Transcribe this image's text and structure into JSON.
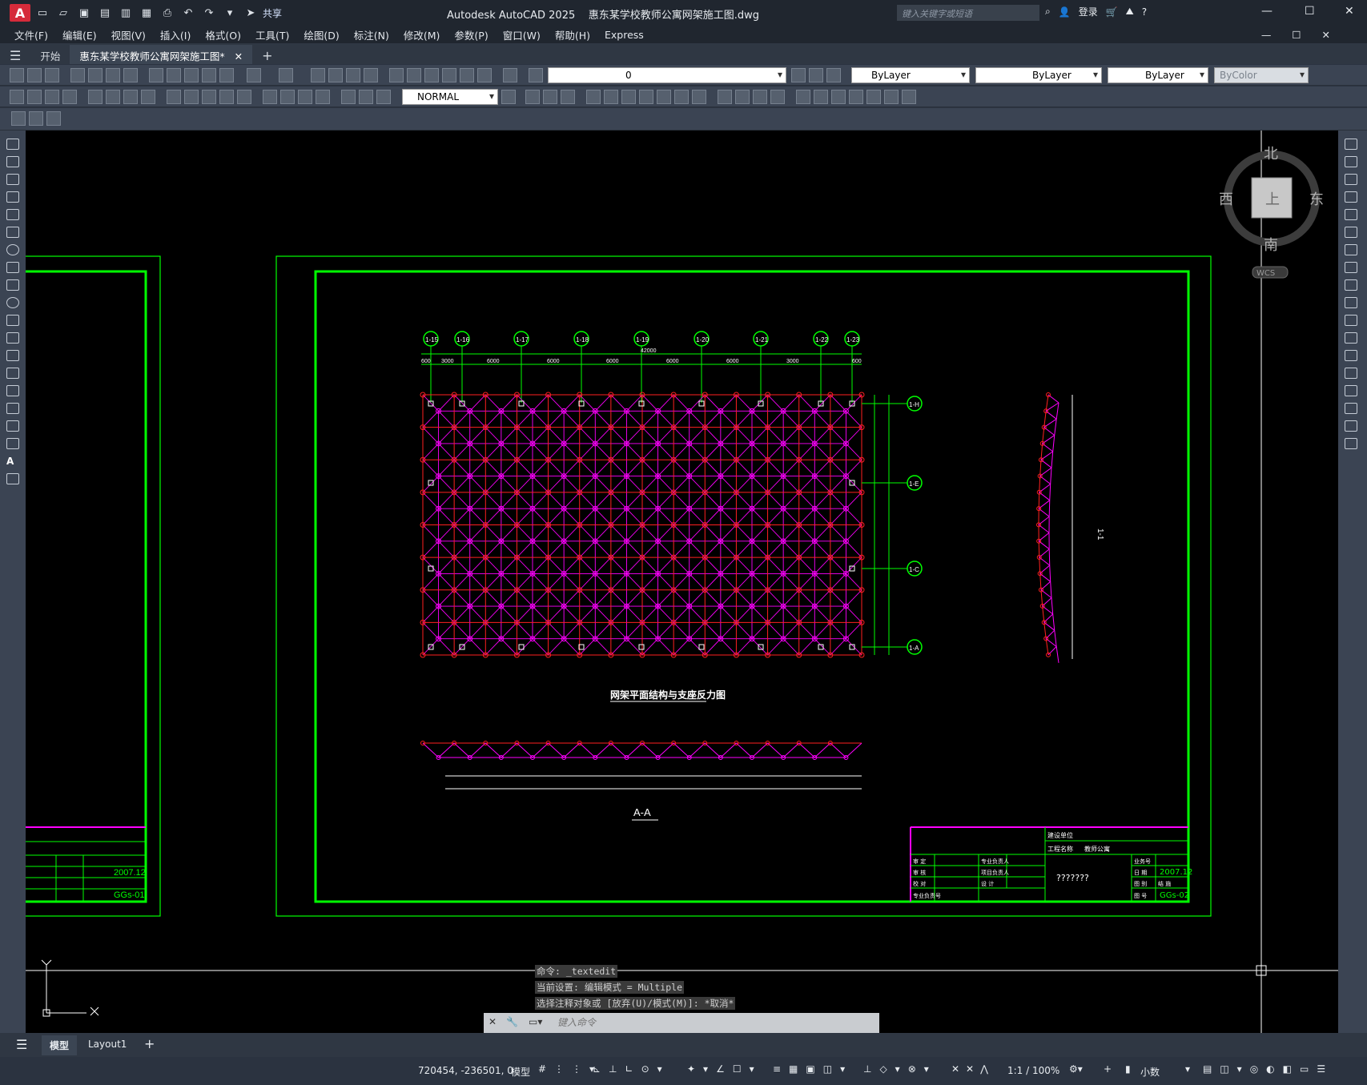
{
  "app": {
    "title": "Autodesk AutoCAD 2025",
    "file": "惠东某学校教师公寓网架施工图.dwg",
    "logo": "A",
    "share": "共享",
    "search_placeholder": "键入关键字或短语",
    "login": "登录"
  },
  "menu": [
    "文件(F)",
    "编辑(E)",
    "视图(V)",
    "插入(I)",
    "格式(O)",
    "工具(T)",
    "绘图(D)",
    "标注(N)",
    "修改(M)",
    "参数(P)",
    "窗口(W)",
    "帮助(H)",
    "Express"
  ],
  "tabs": {
    "start": "开始",
    "active": "惠东某学校教师公寓网架施工图*"
  },
  "layer": {
    "name": "0",
    "color": "ByLayer",
    "linetype": "ByLayer",
    "lineweight": "ByLayer",
    "plotstyle": "ByColor",
    "textstyle": "NORMAL"
  },
  "viewcube": {
    "north": "北",
    "south": "南",
    "east": "东",
    "west": "西",
    "top": "上",
    "wcs": "WCS"
  },
  "drawing": {
    "axes_top": [
      "1-15",
      "1-16",
      "1-17",
      "1-18",
      "1-19",
      "1-20",
      "1-21",
      "1-22",
      "1-23"
    ],
    "axes_right": [
      "1-H",
      "1-E",
      "1-C",
      "1-A"
    ],
    "dims_top": [
      "600",
      "3000",
      "6000",
      "6000",
      "6000",
      "6000",
      "6000",
      "3000",
      "600"
    ],
    "total_top": "42000",
    "plan_title": "网架平面结构与支座反力图",
    "section_title": "A-A",
    "section_label": "1-1",
    "titleblock": {
      "build_unit": "建设单位",
      "project_name": "工程名称",
      "project_value": "教师公寓",
      "unknown": "???????",
      "date": "2007.12",
      "sheet": "GGs-02",
      "date_left": "2007.12",
      "sheet_left": "GGs-01",
      "rows": [
        "审 定",
        "审 核",
        "校 对",
        "专业负责人",
        "项目负责人",
        "设 计",
        "专业负责号",
        "业务号",
        "日 期",
        "图 别",
        "图 号",
        "结 施"
      ]
    }
  },
  "command": {
    "history": [
      "命令: _textedit",
      "当前设置: 编辑模式 = Multiple",
      "选择注释对象或 [放弃(U)/模式(M)]: *取消*"
    ],
    "placeholder": "键入命令"
  },
  "layouts": [
    "模型",
    "Layout1"
  ],
  "status": {
    "coords": "720454, -236501, 0",
    "mode": "模型",
    "scale": "1:1 / 100%",
    "units": "小数"
  },
  "colors": {
    "green": "#00ff00",
    "magenta": "#ff00ff",
    "red": "#ff2020",
    "white": "#ffffff"
  }
}
